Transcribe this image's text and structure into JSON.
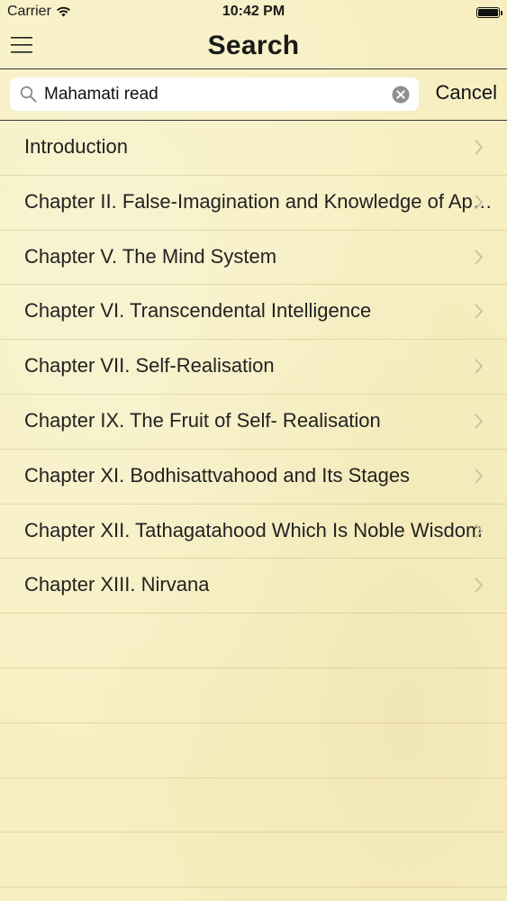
{
  "status_bar": {
    "carrier": "Carrier",
    "time": "10:42 PM"
  },
  "nav": {
    "title": "Search",
    "menu_icon": "hamburger-menu-icon"
  },
  "search": {
    "query": "Mahamati read",
    "cancel_label": "Cancel",
    "search_icon": "search-icon",
    "clear_icon": "clear-icon"
  },
  "results": [
    {
      "title": "Introduction"
    },
    {
      "title": "Chapter II. False-Imagination and Knowledge of Appearances"
    },
    {
      "title": "Chapter V. The Mind System"
    },
    {
      "title": "Chapter VI. Transcendental Intelligence"
    },
    {
      "title": "Chapter VII. Self-Realisation"
    },
    {
      "title": "Chapter IX. The Fruit of Self- Realisation"
    },
    {
      "title": "Chapter XI. Bodhisattvahood and Its Stages"
    },
    {
      "title": "Chapter XII. Tathagatahood Which Is Noble Wisdom"
    },
    {
      "title": "Chapter XIII. Nirvana"
    }
  ],
  "colors": {
    "background": "#f7efc2",
    "separator": "#3a3a3a",
    "chevron": "#c9c2a4"
  }
}
